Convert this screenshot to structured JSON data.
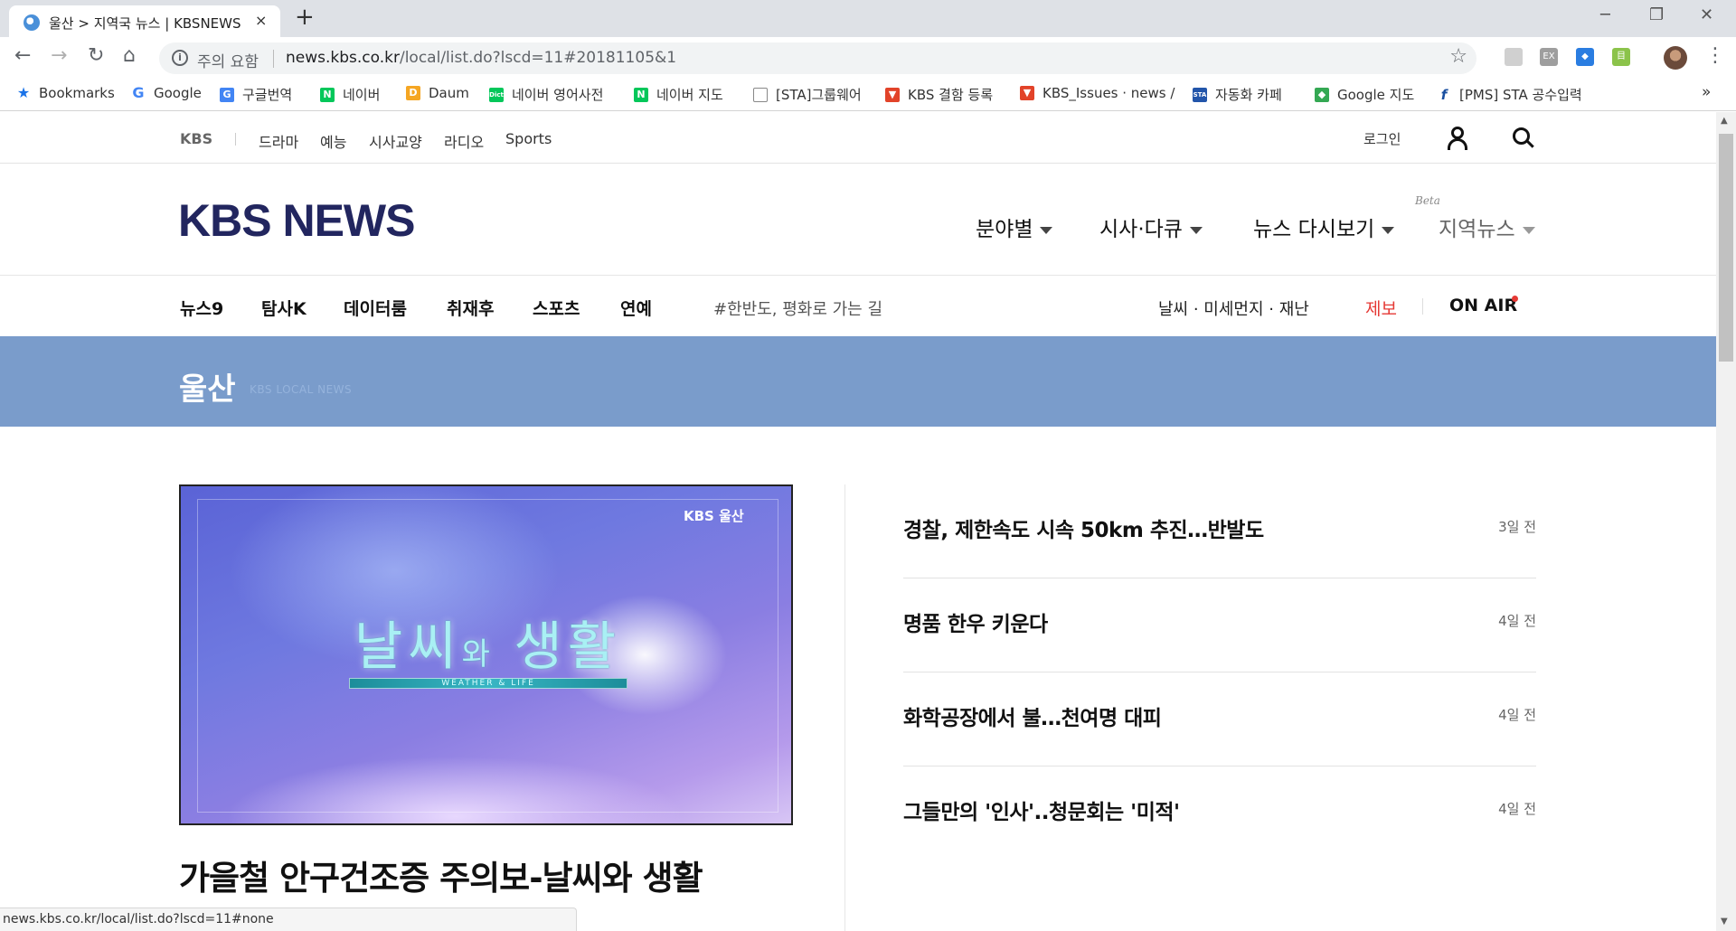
{
  "browser": {
    "tab_title": "울산 > 지역국 뉴스 | KBSNEWS",
    "tab_close": "×",
    "new_tab": "+",
    "window_controls": {
      "minimize": "─",
      "maximize": "❐",
      "close": "✕"
    },
    "nav": {
      "back": "←",
      "forward": "→",
      "reload": "↻",
      "home": "⌂"
    },
    "security_label": "주의 요함",
    "url_host": "news.kbs.co.kr",
    "url_path": "/local/list.do?lscd=11#20181105&1",
    "bookmark_star": "☆",
    "menu": "⋮",
    "status_url": "news.kbs.co.kr/local/list.do?lscd=11#none"
  },
  "bookmarks": [
    {
      "label": "Bookmarks",
      "icon": "star-icon",
      "color": "#1a73e8"
    },
    {
      "label": "Google",
      "icon": "google-icon",
      "color": "#4285f4"
    },
    {
      "label": "구글번역",
      "icon": "translate-icon",
      "color": "#4285f4"
    },
    {
      "label": "네이버",
      "icon": "naver-icon",
      "color": "#03c75a"
    },
    {
      "label": "Daum",
      "icon": "daum-icon",
      "color": "#f5a623"
    },
    {
      "label": "네이버 영어사전",
      "icon": "dict-icon",
      "color": "#03c75a"
    },
    {
      "label": "네이버 지도",
      "icon": "naver-icon",
      "color": "#03c75a"
    },
    {
      "label": "[STA]그룹웨어",
      "icon": "page-icon",
      "color": "#888888"
    },
    {
      "label": "KBS 결함 등록",
      "icon": "gitlab-icon",
      "color": "#e24329"
    },
    {
      "label": "KBS_Issues · news / ",
      "icon": "gitlab-icon",
      "color": "#e24329"
    },
    {
      "label": "자동화 카페",
      "icon": "sta-icon",
      "color": "#2255aa"
    },
    {
      "label": "Google 지도",
      "icon": "maps-icon",
      "color": "#34a853"
    },
    {
      "label": "[PMS] STA 공수입력",
      "icon": "pms-icon",
      "color": "#1a4fa0"
    }
  ],
  "bookmarks_more": "»",
  "kbs": {
    "top_logo": "KBS",
    "top_nav": [
      "드라마",
      "예능",
      "시사교양",
      "라디오",
      "Sports"
    ],
    "login": "로그인",
    "logo": "KBS NEWS",
    "main_menu": [
      "분야별",
      "시사·다큐",
      "뉴스 다시보기",
      "지역뉴스"
    ],
    "beta": "Beta",
    "sub_nav": [
      "뉴스9",
      "탐사K",
      "데이터룸",
      "취재후",
      "스포츠",
      "연예"
    ],
    "hashtag": "#한반도, 평화로 가는 길",
    "weather": "날씨 · 미세먼지 · 재난",
    "report": "제보",
    "on_air": "ON AIR",
    "region": "울산",
    "region_sub": "KBS LOCAL NEWS",
    "featured": {
      "badge": "KBS 울산",
      "title_a": "날씨",
      "title_b": "와",
      "title_c": "생활",
      "bar_label": "WEATHER & LIFE",
      "headline": "가을철 안구건조증 주의보-날씨와 생활"
    },
    "news": [
      {
        "title": "경찰, 제한속도 시속 50km 추진…반발도",
        "time": "3일 전"
      },
      {
        "title": "명품 한우 키운다",
        "time": "4일 전"
      },
      {
        "title": "화학공장에서 불…천여명 대피",
        "time": "4일 전"
      },
      {
        "title": "그들만의 '인사'..청문회는 '미적'",
        "time": "4일 전"
      }
    ],
    "colors": {
      "brand_navy": "#22265f",
      "region_banner": "#7a9ccb",
      "report_red": "#e53935"
    }
  }
}
